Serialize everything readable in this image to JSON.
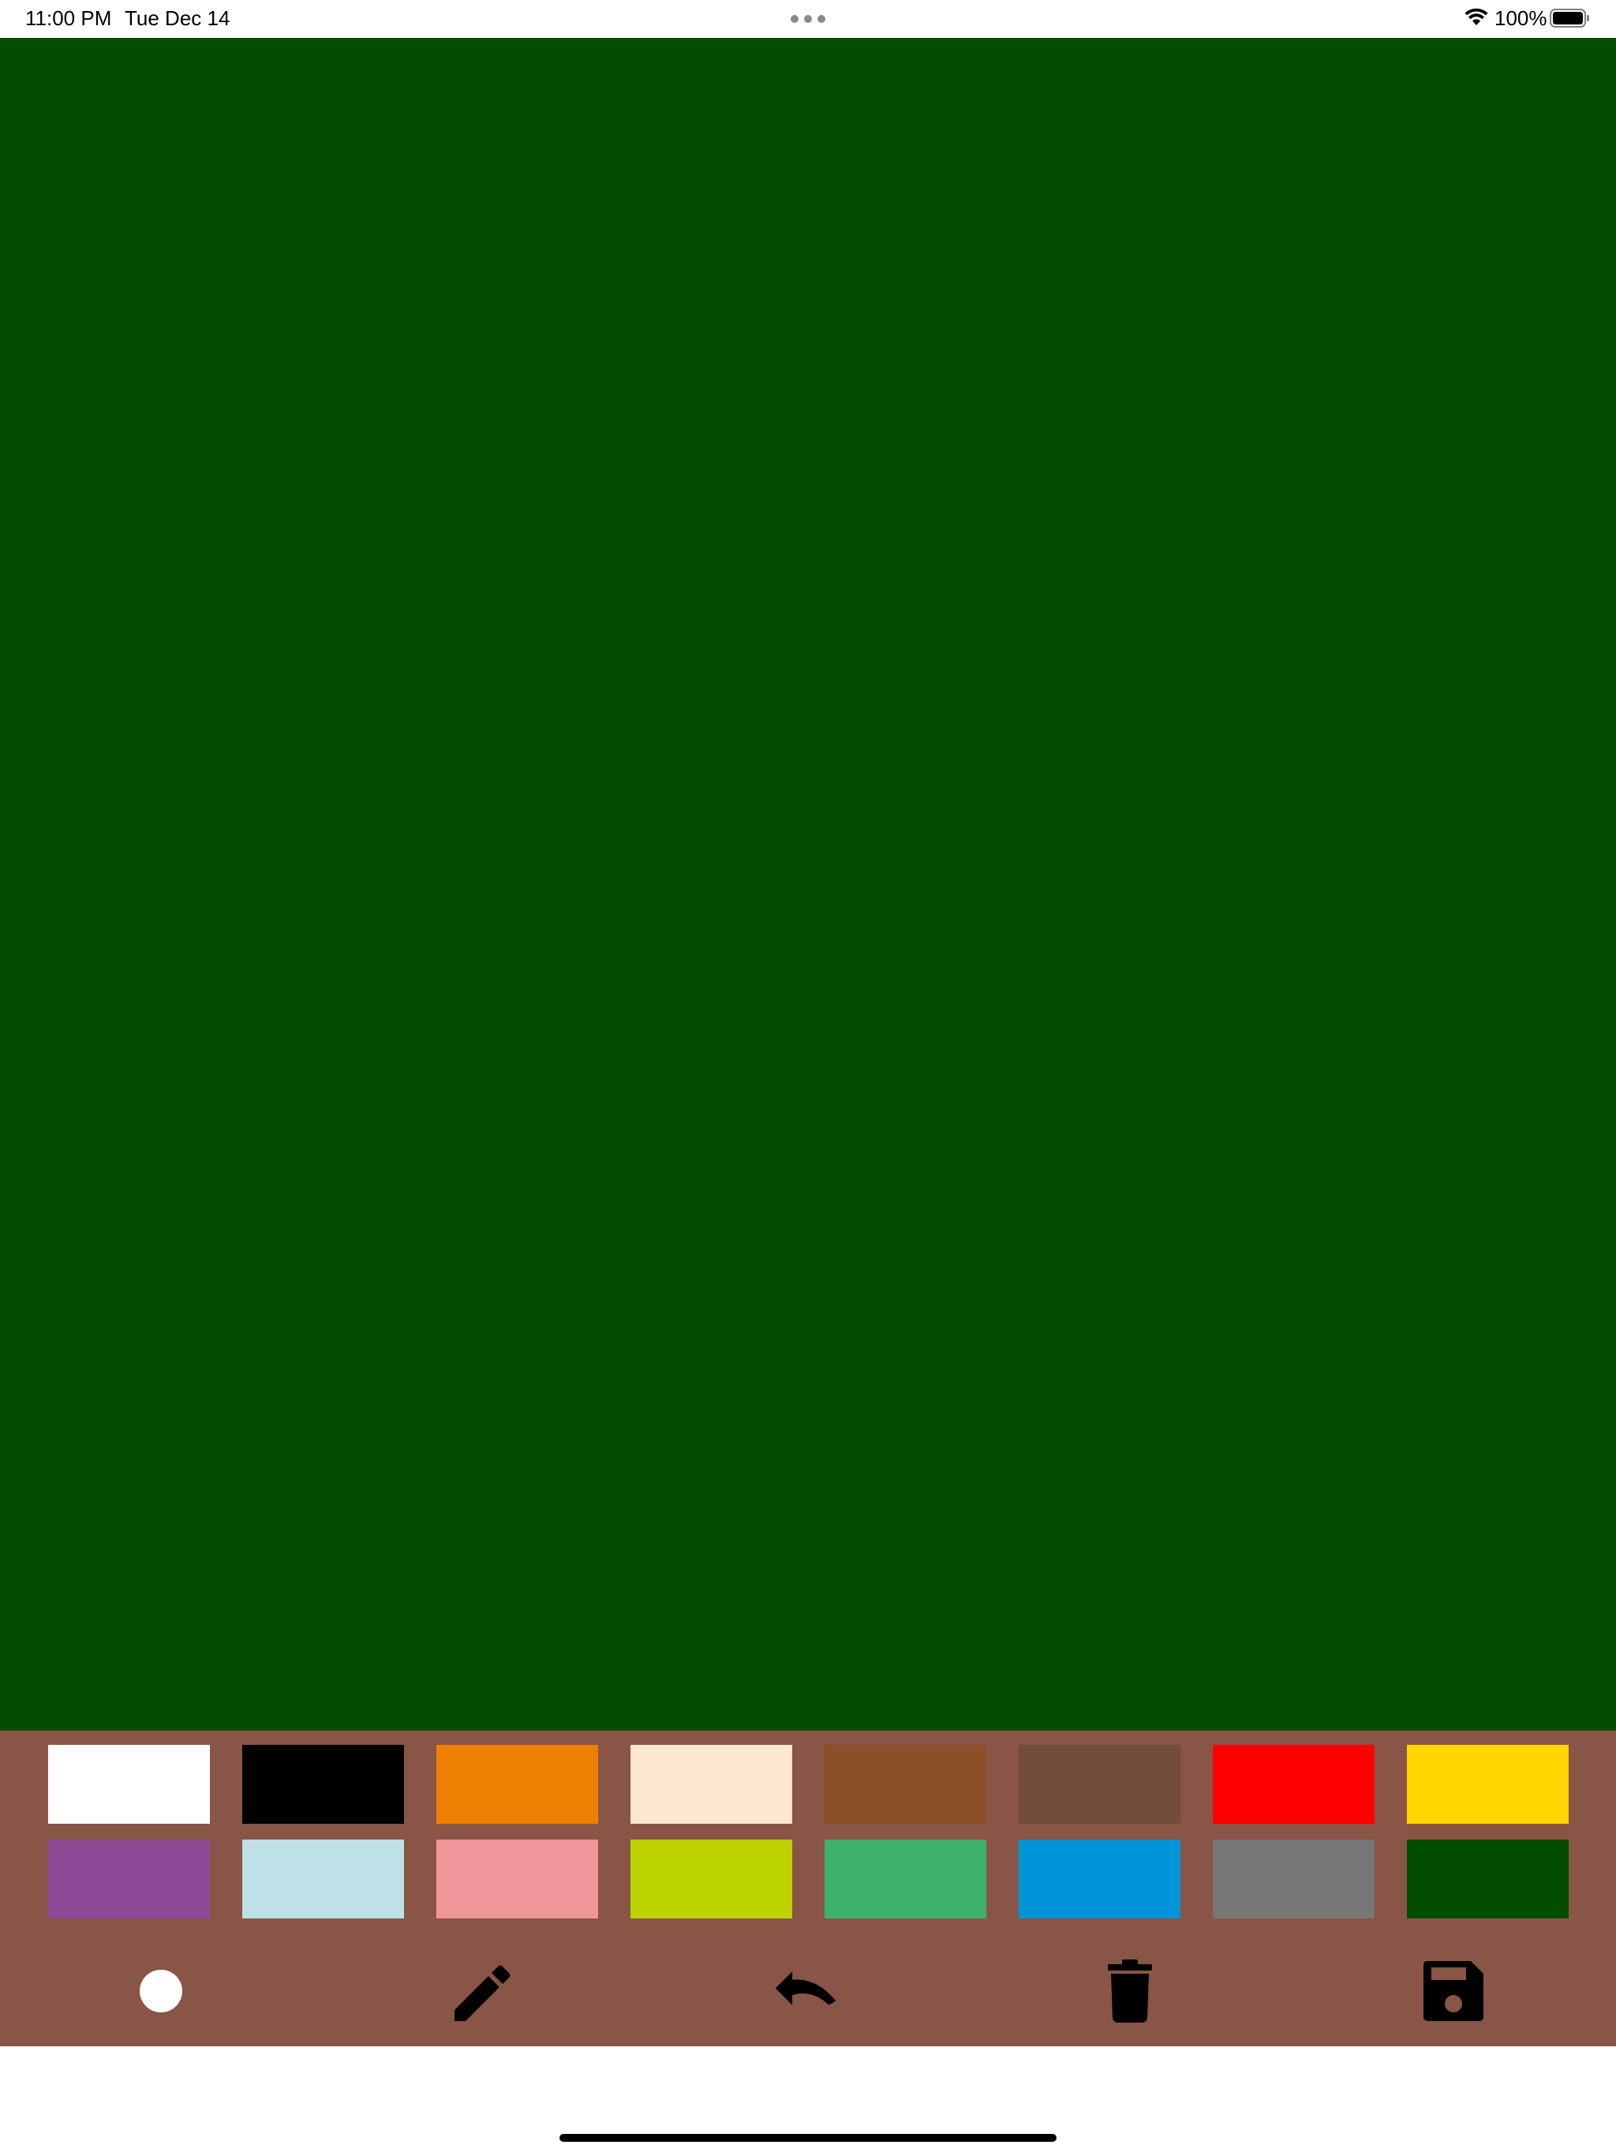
{
  "status_bar": {
    "time": "11:00 PM",
    "date": "Tue Dec 14",
    "battery": "100%"
  },
  "canvas": {
    "background_color": "#024d00"
  },
  "palette": {
    "background_color": "#885546",
    "colors": [
      "#ffffff",
      "#000000",
      "#ee8000",
      "#fde6d2",
      "#8b4f2a",
      "#734c3c",
      "#ff0000",
      "#ffd600",
      "#8d4a96",
      "#bde1e6",
      "#f0959a",
      "#bcd300",
      "#3db26f",
      "#0094d9",
      "#777777",
      "#024d00"
    ]
  },
  "tools": [
    {
      "icon": "brush-size-circle-icon"
    },
    {
      "icon": "pencil-icon"
    },
    {
      "icon": "undo-icon"
    },
    {
      "icon": "trash-icon"
    },
    {
      "icon": "save-floppy-icon"
    }
  ]
}
